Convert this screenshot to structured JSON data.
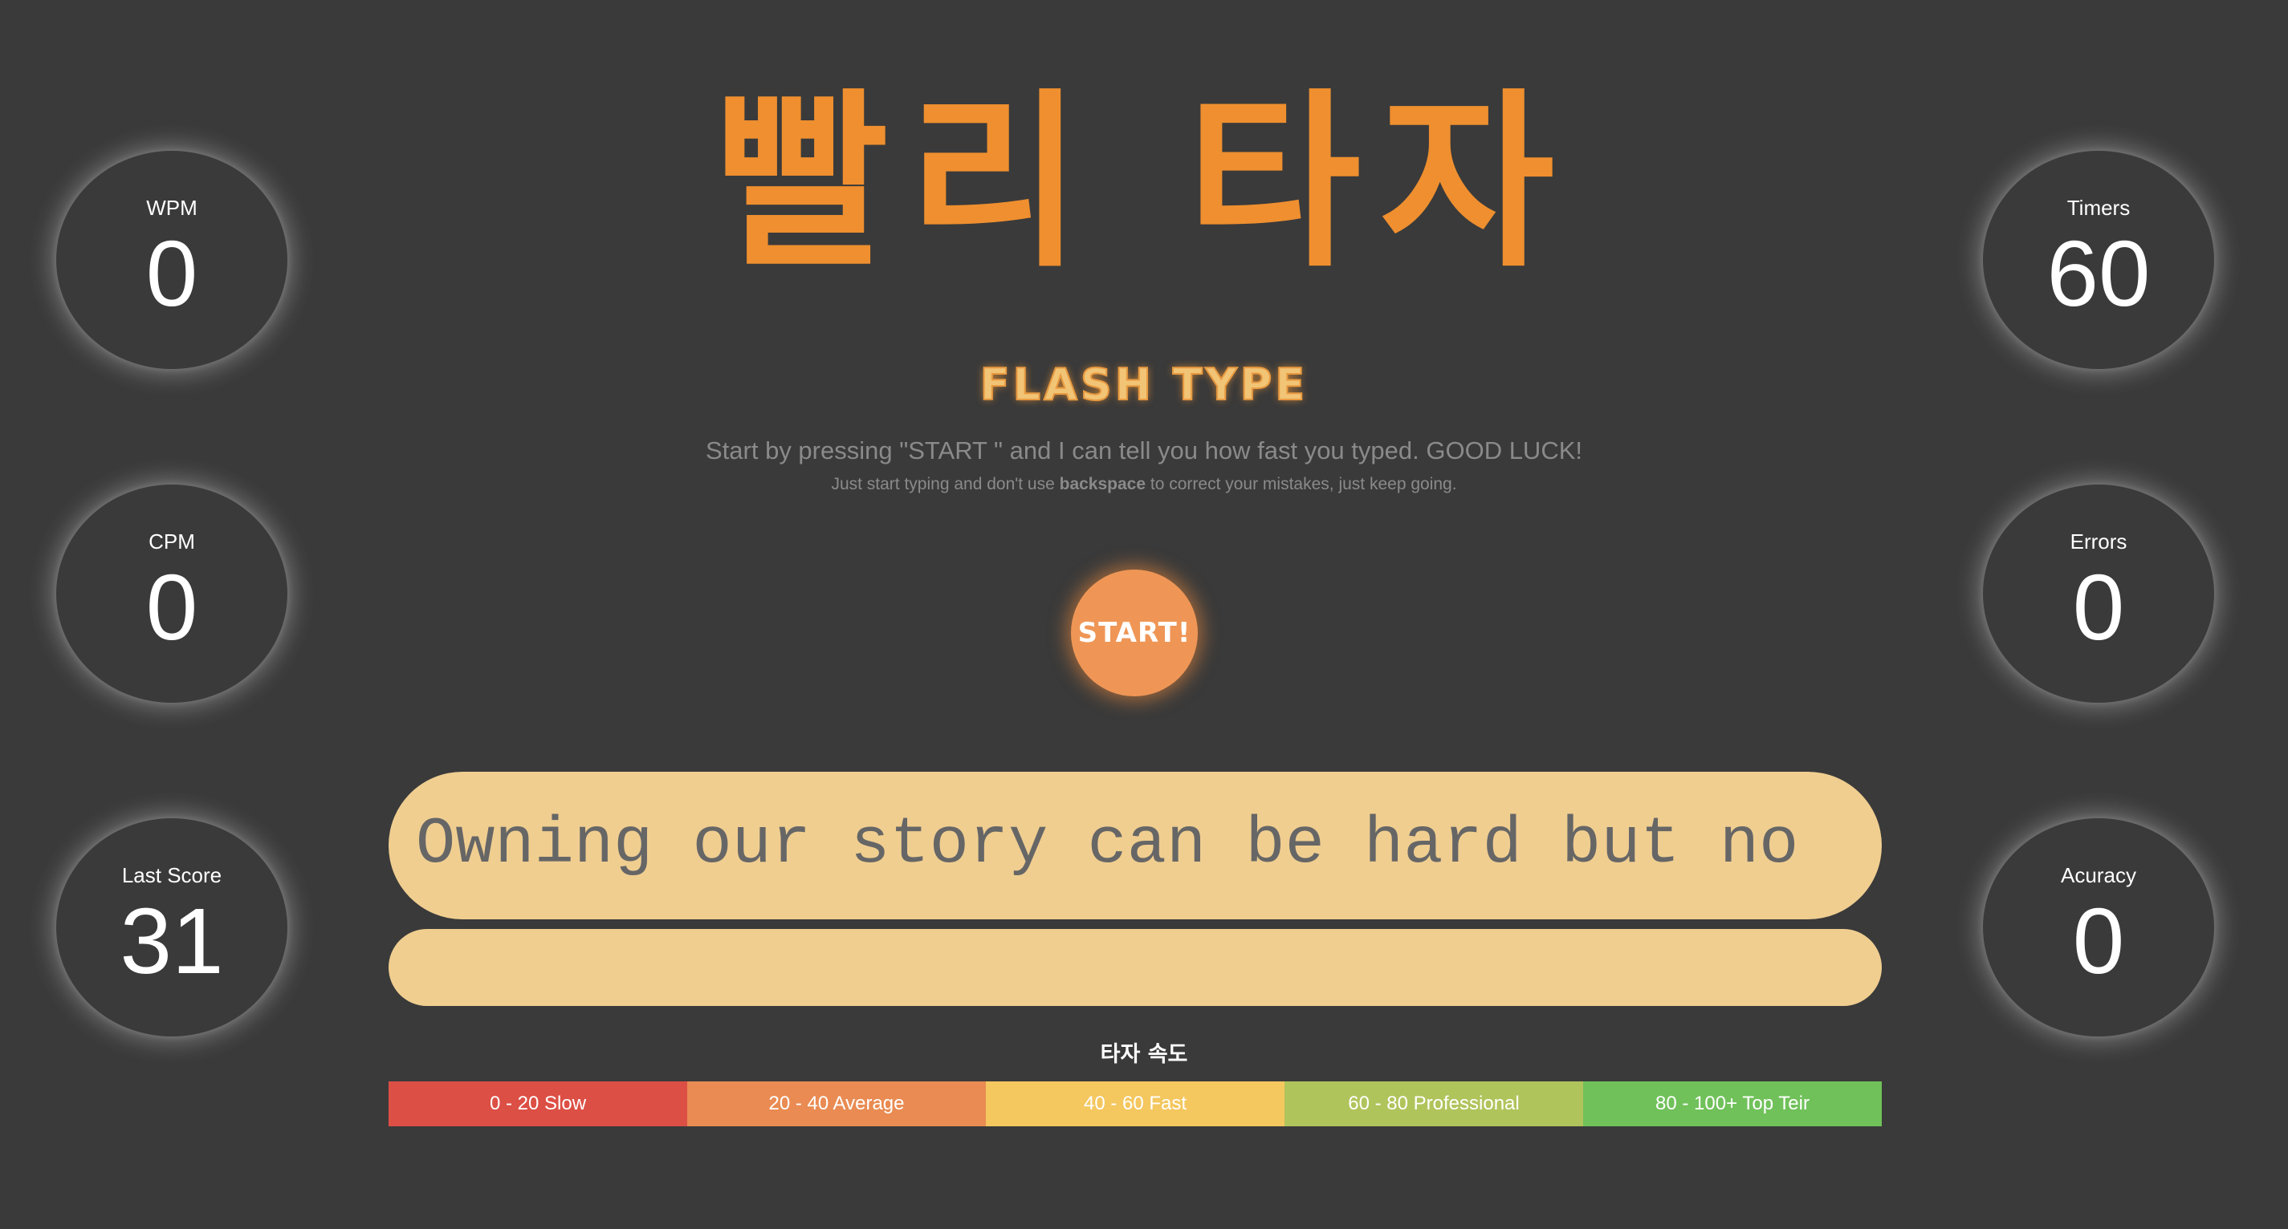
{
  "header": {
    "title": "빨리 타자",
    "subtitle": "FLASH TYPE",
    "description": "Start by pressing \"START \" and I can tell you how fast you typed. GOOD LUCK!",
    "hint_prefix": "Just start typing and don't use ",
    "hint_bold": "backspace",
    "hint_suffix": " to correct your mistakes, just keep going."
  },
  "stats": {
    "wpm": {
      "label": "WPM",
      "value": "0"
    },
    "cpm": {
      "label": "CPM",
      "value": "0"
    },
    "last_score": {
      "label": "Last Score",
      "value": "31"
    },
    "timer": {
      "label": "Timers",
      "value": "60"
    },
    "errors": {
      "label": "Errors",
      "value": "0"
    },
    "accuracy": {
      "label": "Acuracy",
      "value": "0"
    }
  },
  "start_button": {
    "label": "START!"
  },
  "typing": {
    "text": "Owning our story can be hard but no",
    "input_value": ""
  },
  "speed_legend": {
    "title": "타자 속도",
    "segments": [
      {
        "label": "0 - 20 Slow",
        "color": "#dc4f45"
      },
      {
        "label": "20 - 40 Average",
        "color": "#e98b52"
      },
      {
        "label": "40 - 60 Fast",
        "color": "#f4c75f"
      },
      {
        "label": "60 - 80 Professional",
        "color": "#b0c45c"
      },
      {
        "label": "80 - 100+ Top Teir",
        "color": "#70c15a"
      }
    ]
  }
}
